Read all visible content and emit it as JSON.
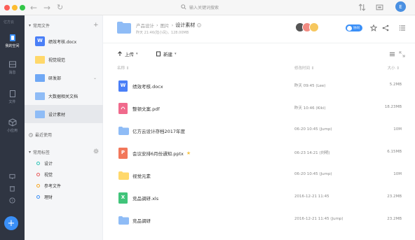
{
  "search": {
    "placeholder": "输入关键词搜索"
  },
  "user": {
    "initial": "E"
  },
  "rail": {
    "logo": "亿方云",
    "items": [
      {
        "label": "我的空间",
        "active": true
      },
      {
        "label": "消息"
      },
      {
        "label": "文件"
      },
      {
        "label": "小应用"
      }
    ]
  },
  "sidebar": {
    "favorites_title": "常用文件",
    "files": [
      {
        "name": "绩效考核.docx",
        "type": "word",
        "color": "#4a7ff7"
      },
      {
        "name": "视觉规范",
        "type": "folder-yellow",
        "color": "#ffd86b"
      },
      {
        "name": "研发部",
        "type": "folder-blue",
        "color": "#6fa8f5",
        "has_chevron": true
      },
      {
        "name": "大数据相关文档",
        "type": "folder-blue",
        "color": "#8fbcf6"
      },
      {
        "name": "设计素材",
        "type": "folder-blue",
        "color": "#8fbcf6",
        "selected": true
      }
    ],
    "recent": "最近使用",
    "tags_title": "常用标签",
    "tags": [
      {
        "name": "设计",
        "color": "#2ec4b6"
      },
      {
        "name": "视觉",
        "color": "#e85a5a"
      },
      {
        "name": "参考文件",
        "color": "#f5a623"
      },
      {
        "name": "理财",
        "color": "#3a8ff7"
      }
    ]
  },
  "header": {
    "breadcrumb": [
      "产品设计",
      "图片",
      "设计素材"
    ],
    "meta": "昨天 21:46(陆小凤)，128.00MB",
    "avatars": [
      {
        "color": "#666",
        "text": ""
      },
      {
        "color": "#f28b82",
        "text": ""
      },
      {
        "color": "#f6c75e",
        "text": ""
      }
    ],
    "toggle_label": "协同"
  },
  "toolbar": {
    "upload": "上传",
    "new": "新建"
  },
  "columns": {
    "name": "名称 ⇕",
    "modified": "修改时间 ⇕",
    "size": "大小 ⇕"
  },
  "files": [
    {
      "name": "绩效考核.docx",
      "date": "昨天 09:45 (Lee)",
      "size": "5.2MB",
      "icon": "word",
      "color": "#4a7ff7",
      "glyph": "W"
    },
    {
      "name": "整顿文案.pdf",
      "date": "昨天 10:46 (Kiki)",
      "size": "18.23MB",
      "icon": "pdf",
      "color": "#f06a8c",
      "glyph": ""
    },
    {
      "name": "亿方云设计存档2017年度",
      "date": "06-20 10:45 (Jump)",
      "size": "10M",
      "icon": "folder-blue",
      "color": "#8fbcf6",
      "glyph": ""
    },
    {
      "name": "会议安排6月份通知.pptx",
      "date": "06-23 14:21 (刘明)",
      "size": "6.15MB",
      "icon": "ppt",
      "color": "#f2775a",
      "glyph": "P",
      "starred": true
    },
    {
      "name": "视觉元素",
      "date": "06-20 10:45 (Jump)",
      "size": "10M",
      "icon": "folder-yellow",
      "color": "#ffd86b",
      "glyph": ""
    },
    {
      "name": "竞品调研.xls",
      "date": "2016-12-21 11:45",
      "size": "23.2MB",
      "icon": "excel",
      "color": "#41c47a",
      "glyph": "X"
    },
    {
      "name": "竞品调研",
      "date": "2016-12-21 11:45 (Jump)",
      "size": "23.2MB",
      "icon": "folder-blue",
      "color": "#8fbcf6",
      "glyph": ""
    }
  ]
}
